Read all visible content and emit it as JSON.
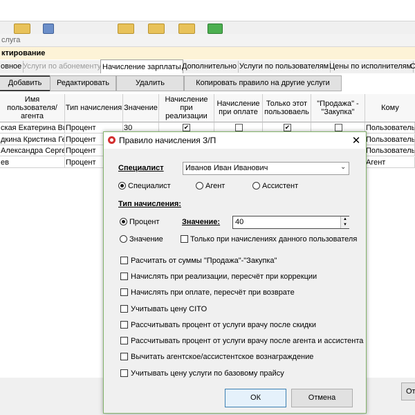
{
  "background": {
    "window_title": "слуга",
    "section_label": "ктирование",
    "tabs": [
      {
        "label": "овное",
        "state": "normal"
      },
      {
        "label": "Услуги по абонементу",
        "state": "disabled"
      },
      {
        "label": "Начисление зарплаты",
        "state": "active"
      },
      {
        "label": "Дополнительно",
        "state": "normal"
      },
      {
        "label": "Услуги по пользователям",
        "state": "normal"
      },
      {
        "label": "Цены по исполнителям",
        "state": "normal"
      },
      {
        "label": "С",
        "state": "normal"
      }
    ],
    "buttons": {
      "add": "Добавить",
      "edit": "Редактировать",
      "delete": "Удалить",
      "copy_rule": "Копировать правило на другие услуги"
    },
    "grid": {
      "headers": [
        "Имя пользователя/агента",
        "Тип начисления",
        "Значение",
        "Начисление при реализации",
        "Начисление при оплате",
        "Только этот пользоваель",
        "\"Продажа\" - \"Закупка\"",
        "Кому"
      ],
      "rows": [
        {
          "name": "ская Екатерина Ви",
          "type": "Процент",
          "value": "30",
          "realization": true,
          "payment": false,
          "only_user": true,
          "sale_purchase": false,
          "whom": "Пользователь"
        },
        {
          "name": "дкина Кристина Ге",
          "type": "Процент",
          "value": "",
          "realization": false,
          "payment": false,
          "only_user": false,
          "sale_purchase": false,
          "whom": "Пользователь"
        },
        {
          "name": "Александра Сергее",
          "type": "Процент",
          "value": "",
          "realization": false,
          "payment": false,
          "only_user": false,
          "sale_purchase": false,
          "whom": "Пользователь"
        },
        {
          "name": "ев",
          "type": "Процент",
          "value": "",
          "realization": false,
          "payment": false,
          "only_user": false,
          "sale_purchase": false,
          "whom": "Агент"
        }
      ]
    },
    "bottom_button_partial": "От"
  },
  "dialog": {
    "title": "Правило начисления З/П",
    "close_icon": "close-icon",
    "specialist_label": "Специалист",
    "specialist_value": "Иванов Иван Иванович",
    "role_options": [
      {
        "label": "Специалист",
        "selected": true
      },
      {
        "label": "Агент",
        "selected": false
      },
      {
        "label": "Ассистент",
        "selected": false
      }
    ],
    "accrual_type_label": "Тип начисления:",
    "accrual_options": [
      {
        "label": "Процент",
        "selected": true
      },
      {
        "label": "Значение",
        "selected": false
      }
    ],
    "value_label": "Значение:",
    "value": "40",
    "only_user_accruals": {
      "label": "Только при начислениях данного пользователя",
      "checked": false
    },
    "options": [
      {
        "label": "Расчитать от суммы \"Продажа\"-\"Закупка\"",
        "checked": false
      },
      {
        "label": "Начислять при реализации, пересчёт при коррекции",
        "checked": false
      },
      {
        "label": "Начислять при оплате, пересчёт при возврате",
        "checked": false
      },
      {
        "label": "Учитывать цену CITO",
        "checked": false
      },
      {
        "label": "Рассчитывать процент от услуги врачу после скидки",
        "checked": false
      },
      {
        "label": "Рассчитывать процент от услуги врачу после агента и ассистента",
        "checked": false
      },
      {
        "label": "Вычитать агентское/ассистентское вознаграждение",
        "checked": false
      },
      {
        "label": "Учитывать цену услуги по базовому прайсу",
        "checked": false
      }
    ],
    "ok_label": "ОК",
    "cancel_label": "Отмена"
  },
  "colors": {
    "dialog_border": "#83b36b",
    "section_highlight": "#fdf3d7",
    "ok_border": "#3c7fb1"
  }
}
